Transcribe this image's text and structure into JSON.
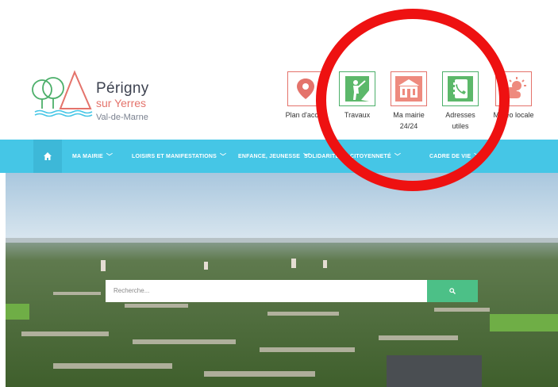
{
  "logo": {
    "title": "Périgny",
    "subtitle": "sur Yerres",
    "department": "Val-de-Marne"
  },
  "quick_links": [
    {
      "label": "Plan d'accès",
      "icon": "map-pin-icon",
      "color": "#e4736b"
    },
    {
      "label": "Travaux",
      "icon": "worker-icon",
      "color": "#4caf6a"
    },
    {
      "label": "Ma mairie 24/24",
      "icon": "town-hall-icon",
      "color": "#e4736b"
    },
    {
      "label": "Adresses utiles",
      "icon": "phone-book-icon",
      "color": "#4caf6a"
    },
    {
      "label": "Météo locale",
      "icon": "weather-icon",
      "color": "#e4736b"
    }
  ],
  "nav": {
    "home_icon": "home-icon",
    "items": [
      {
        "label": "MA MAIRIE"
      },
      {
        "label": "LOISIRS ET MANIFESTATIONS"
      },
      {
        "label": "ENFANCE, JEUNESSE"
      },
      {
        "label": "SOLIDARITÉ ET CITOYENNETÉ"
      },
      {
        "label": "CADRE DE VIE"
      }
    ]
  },
  "search": {
    "placeholder": "Recherche...",
    "button_icon": "search-icon"
  },
  "colors": {
    "nav": "#45c6e6",
    "accent_red": "#e4736b",
    "accent_green": "#4caf6a",
    "search_button": "#4cc087",
    "annotation": "#ee1111"
  }
}
